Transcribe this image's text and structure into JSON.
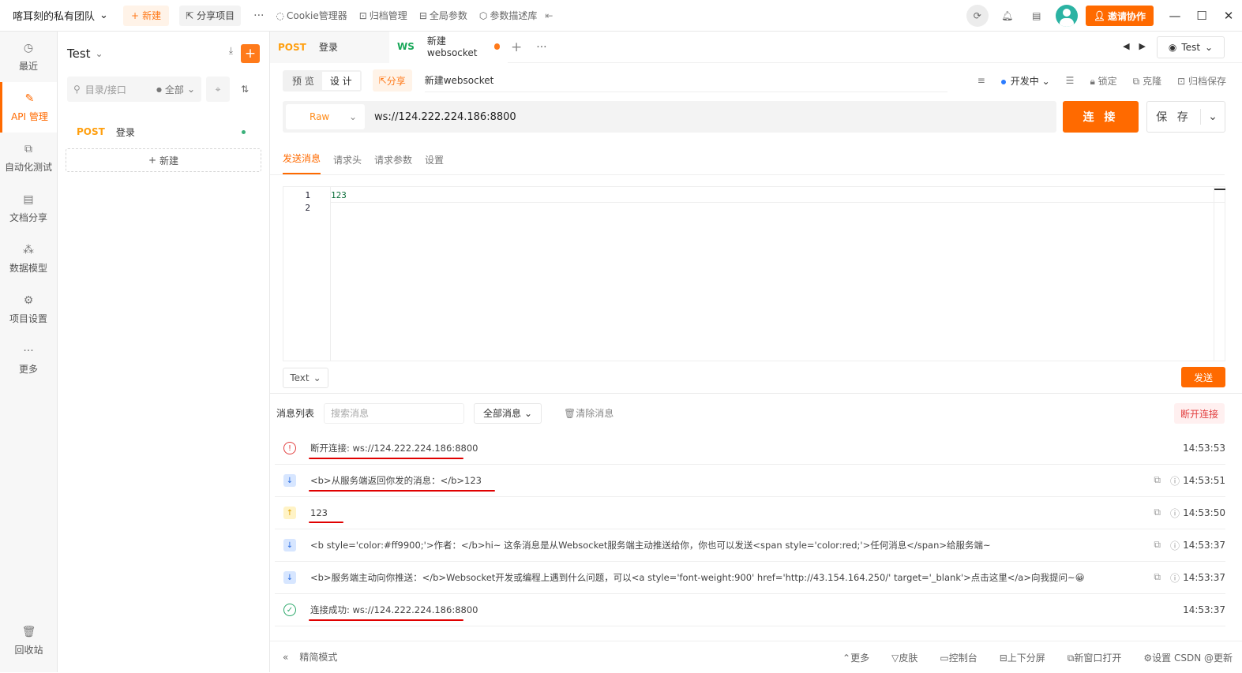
{
  "topbar": {
    "team": "喀耳刻的私有团队",
    "new_label": "新建",
    "share_label": "分享项目",
    "more": "···",
    "tools": [
      {
        "icon": "cookie-icon",
        "label": "Cookie管理器"
      },
      {
        "icon": "archive-icon",
        "label": "归档管理"
      },
      {
        "icon": "global-params-icon",
        "label": "全局参数"
      },
      {
        "icon": "cube-icon",
        "label": "参数描述库"
      }
    ],
    "invite_label": "邀请协作"
  },
  "leftnav": {
    "items": [
      {
        "icon": "clock-icon",
        "label": "最近",
        "active": false
      },
      {
        "icon": "edit-icon",
        "label": "API 管理",
        "active": true
      },
      {
        "icon": "flow-icon",
        "label": "自动化测试",
        "active": false
      },
      {
        "icon": "doc-icon",
        "label": "文档分享",
        "active": false
      },
      {
        "icon": "model-icon",
        "label": "数据模型",
        "active": false
      },
      {
        "icon": "settings-icon",
        "label": "项目设置",
        "active": false
      },
      {
        "icon": "more-icon",
        "label": "更多",
        "active": false
      }
    ],
    "recycle": "回收站"
  },
  "tree": {
    "project": "Test",
    "search_placeholder": "目录/接口",
    "filter": "全部",
    "items": [
      {
        "method": "POST",
        "name": "登录"
      }
    ],
    "new_label": "新建"
  },
  "tabs": [
    {
      "method": "POST",
      "name": "登录"
    },
    {
      "method": "WS",
      "name": "新建websocket"
    }
  ],
  "env": "Test",
  "toolbar2": {
    "preview": "预 览",
    "design": "设 计",
    "share": "分享",
    "name": "新建websocket",
    "status": "开发中",
    "lock": "锁定",
    "clone": "克隆",
    "archive": "归档保存"
  },
  "url": {
    "type": "Raw",
    "value": "ws://124.222.224.186:8800",
    "connect": "连 接",
    "save": "保 存"
  },
  "subtabs": [
    "发送消息",
    "请求头",
    "请求参数",
    "设置"
  ],
  "editor": {
    "lines": [
      "123",
      ""
    ]
  },
  "format": "Text",
  "send": "发送",
  "messages_header": {
    "label": "消息列表",
    "search_placeholder": "搜索消息",
    "filter": "全部消息",
    "clear": "清除消息",
    "disconnect": "断开连接"
  },
  "messages": [
    {
      "type": "error",
      "text": "断开连接: ws://124.222.224.186:8800",
      "time": "14:53:53",
      "actions": false,
      "underline": 196
    },
    {
      "type": "down",
      "text": "<b>从服务端返回你发的消息：</b>123",
      "time": "14:53:51",
      "actions": true,
      "underline": 236
    },
    {
      "type": "up",
      "text": "123",
      "time": "14:53:50",
      "actions": true,
      "underline": 44
    },
    {
      "type": "down",
      "text": "<b style='color:#ff9900;'>作者：</b>hi~ 这条消息是从Websocket服务端主动推送给你，你也可以发送<span style='color:red;'>任何消息</span>给服务端~",
      "time": "14:53:37",
      "actions": true,
      "underline": 0
    },
    {
      "type": "down",
      "text": "<b>服务端主动向你推送：</b>Websocket开发或编程上遇到什么问题，可以<a style='font-weight:900' href='http://43.154.164.250/' target='_blank'>点击这里</a>向我提问~😀",
      "time": "14:53:37",
      "actions": true,
      "underline": 0
    },
    {
      "type": "ok",
      "text": "连接成功: ws://124.222.224.186:8800",
      "time": "14:53:37",
      "actions": false,
      "underline": 196
    }
  ],
  "footer": {
    "simple": "精简模式",
    "items": [
      "更多",
      "皮肤",
      "控制台",
      "上下分屏",
      "新窗口打开",
      "设置 CSDN @更新"
    ]
  },
  "colors": {
    "accent": "#ff6a00",
    "ws": "#1aa85a",
    "post": "#ff9f0f",
    "error": "#e24040"
  }
}
